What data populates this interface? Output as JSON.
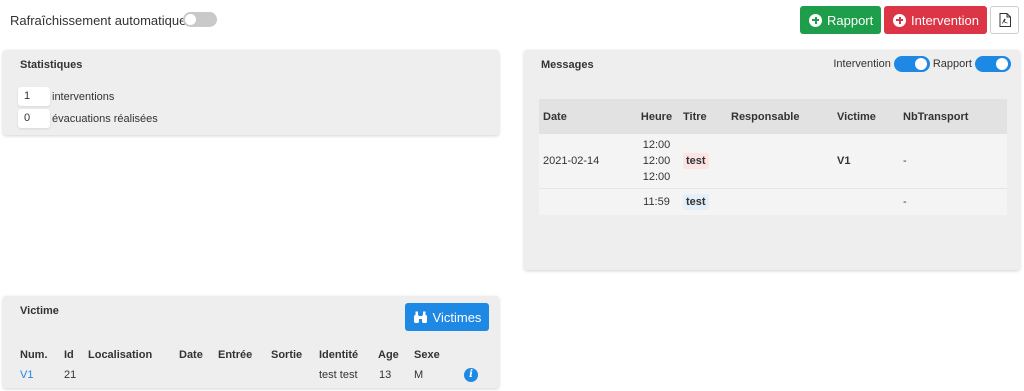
{
  "topbar": {
    "auto_refresh_label": "Rafraîchissement automatique",
    "auto_refresh_on": false,
    "rapport_button": "Rapport",
    "intervention_button": "Intervention"
  },
  "stats": {
    "title": "Statistiques",
    "items": [
      {
        "value": "1",
        "label": "interventions"
      },
      {
        "value": "0",
        "label": "évacuations réalisées"
      }
    ]
  },
  "messages": {
    "title": "Messages",
    "filters": [
      {
        "label": "Intervention",
        "on": true
      },
      {
        "label": "Rapport",
        "on": true
      }
    ],
    "columns": [
      "Date",
      "Heure",
      "Titre",
      "Responsable",
      "Victime",
      "NbTransport"
    ],
    "rows": [
      {
        "date": "2021-02-14",
        "heure": [
          "12:00",
          "12:00",
          "12:00"
        ],
        "titre": "test",
        "titre_type": "intervention",
        "responsable": "",
        "victime": "V1",
        "nbtransport": "-"
      },
      {
        "date": "",
        "heure": [
          "11:59"
        ],
        "titre": "test",
        "titre_type": "rapport",
        "responsable": "",
        "victime": "",
        "nbtransport": "-"
      }
    ]
  },
  "victims": {
    "title": "Victime",
    "button": "Victimes",
    "columns": [
      "Num.",
      "Id",
      "Localisation",
      "Date",
      "Entrée",
      "Sortie",
      "Identité",
      "Age",
      "Sexe"
    ],
    "rows": [
      {
        "num": "V1",
        "id": "21",
        "localisation": "",
        "date": "",
        "entree": "",
        "sortie": "",
        "identite": "test test",
        "age": "13",
        "sexe": "M"
      }
    ]
  },
  "colors": {
    "green": "#1e9e4a",
    "red": "#dc3545",
    "blue": "#1e88e5",
    "panel_bg": "#eeeeee"
  }
}
